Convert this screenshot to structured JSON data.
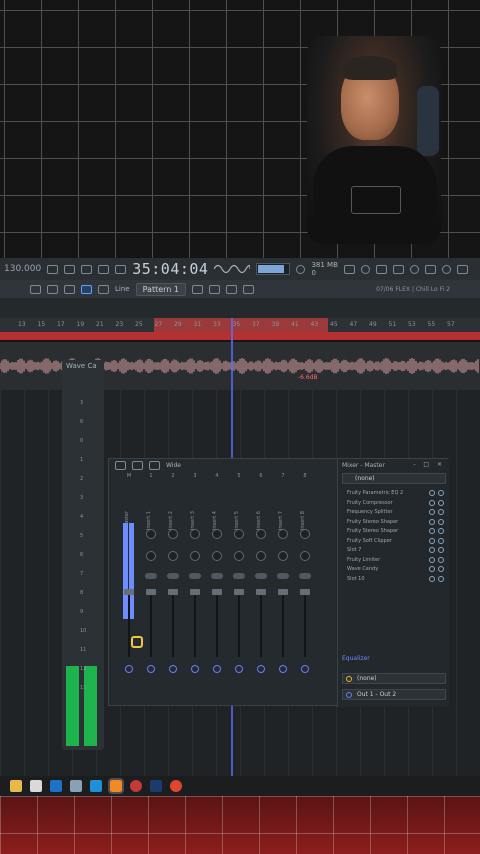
{
  "toolbar": {
    "tempo": "130.000",
    "time": "35:04:04",
    "ram_top": "381 MB",
    "ram_bottom": "0",
    "cpu_fill": 0.8
  },
  "toolbar2": {
    "snap": "Line",
    "pattern": "Pattern 1",
    "hint": "07/06 FLEX | Chill Lo Fi 2"
  },
  "ruler": {
    "marks": [
      "13",
      "15",
      "17",
      "19",
      "21",
      "23",
      "25",
      "27",
      "29",
      "31",
      "33",
      "35",
      "37",
      "39",
      "41",
      "43",
      "45",
      "47",
      "49",
      "51",
      "53",
      "55",
      "57"
    ]
  },
  "audio": {
    "db_label": "-6.6dB"
  },
  "wavecandy": {
    "title": "Wave Ca",
    "scale": [
      "3",
      "6",
      "0",
      "1",
      "2",
      "3",
      "4",
      "5",
      "6",
      "7",
      "8",
      "9",
      "10",
      "11",
      "12",
      "13"
    ]
  },
  "mixer": {
    "toolbar_label": "Wide",
    "strip_numbers": [
      "M",
      "1",
      "2",
      "3",
      "4",
      "5",
      "6",
      "7",
      "8"
    ],
    "strip_names": [
      "Master",
      "Insert 1",
      "Insert 2",
      "Insert 3",
      "Insert 4",
      "Insert 5",
      "Insert 6",
      "Insert 7",
      "Insert 8"
    ],
    "panel": {
      "title": "Mixer - Master",
      "win_buttons": "- □ ×",
      "preset": "(none)",
      "slots": [
        "Fruity Parametric EQ 2",
        "Fruity Compressor",
        "Frequency Splitter",
        "Fruity Stereo Shaper",
        "Fruity Stereo Shaper",
        "Fruity Soft Clipper",
        "Slot 7",
        "Fruity Limiter",
        "Wave Candy",
        "Slot 10"
      ],
      "eq_label": "Equalizer",
      "route_in": "(none)",
      "route_out": "Out 1 - Out 2"
    }
  }
}
